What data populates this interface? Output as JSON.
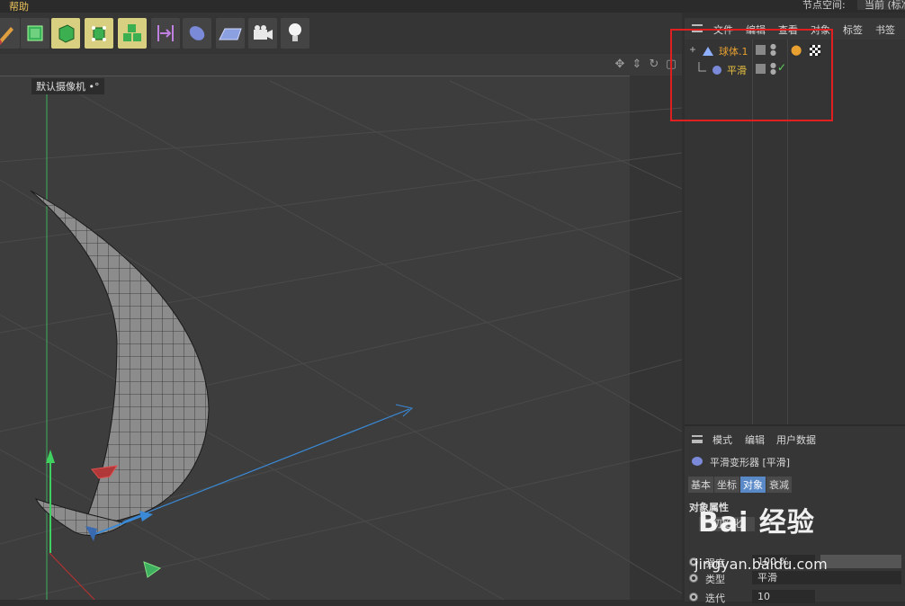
{
  "menubar": {
    "help_label": "帮助",
    "node_space_label": "节点空间:",
    "node_space_value": "当前 (标准/物理)"
  },
  "toolbar": {
    "tools": [
      {
        "name": "paint-tool",
        "active": false
      },
      {
        "name": "cube-tool",
        "active": false
      },
      {
        "name": "object-mode",
        "active": true
      },
      {
        "name": "point-mode",
        "active": true
      },
      {
        "name": "array-tool",
        "active": true
      },
      {
        "name": "bend-tool",
        "active": false
      },
      {
        "name": "smooth-tool",
        "active": false
      },
      {
        "name": "floor-tool",
        "active": false
      },
      {
        "name": "camera-tool",
        "active": false
      },
      {
        "name": "light-tool",
        "active": false
      }
    ]
  },
  "viewport": {
    "camera_label": "默认摄像机",
    "camera_dot": "•°"
  },
  "object_manager": {
    "menu": [
      "文件",
      "编辑",
      "查看",
      "对象",
      "标签",
      "书签"
    ],
    "objects": [
      {
        "name": "球体.1",
        "level": 0
      },
      {
        "name": "平滑",
        "level": 1
      }
    ]
  },
  "attribute_manager": {
    "menu": [
      "模式",
      "编辑",
      "用户数据"
    ],
    "title": "平滑变形器 [平滑]",
    "tabs": [
      "基本",
      "坐标",
      "对象",
      "衰减"
    ],
    "selected_tab": "对象",
    "section": "对象属性",
    "init_button": "初始化",
    "props": [
      {
        "label": "强度",
        "value": "100 %"
      },
      {
        "label": "类型",
        "value": "平滑"
      },
      {
        "label": "迭代",
        "value": "10"
      }
    ]
  },
  "watermark": {
    "logo": "Bai 经验",
    "url": "jingyan.baidu.com"
  },
  "colors": {
    "accent_selected": "#5a89c8",
    "object_name": "#e8a030",
    "highlight_box": "#e02020",
    "tool_active": "#d8cf80"
  }
}
